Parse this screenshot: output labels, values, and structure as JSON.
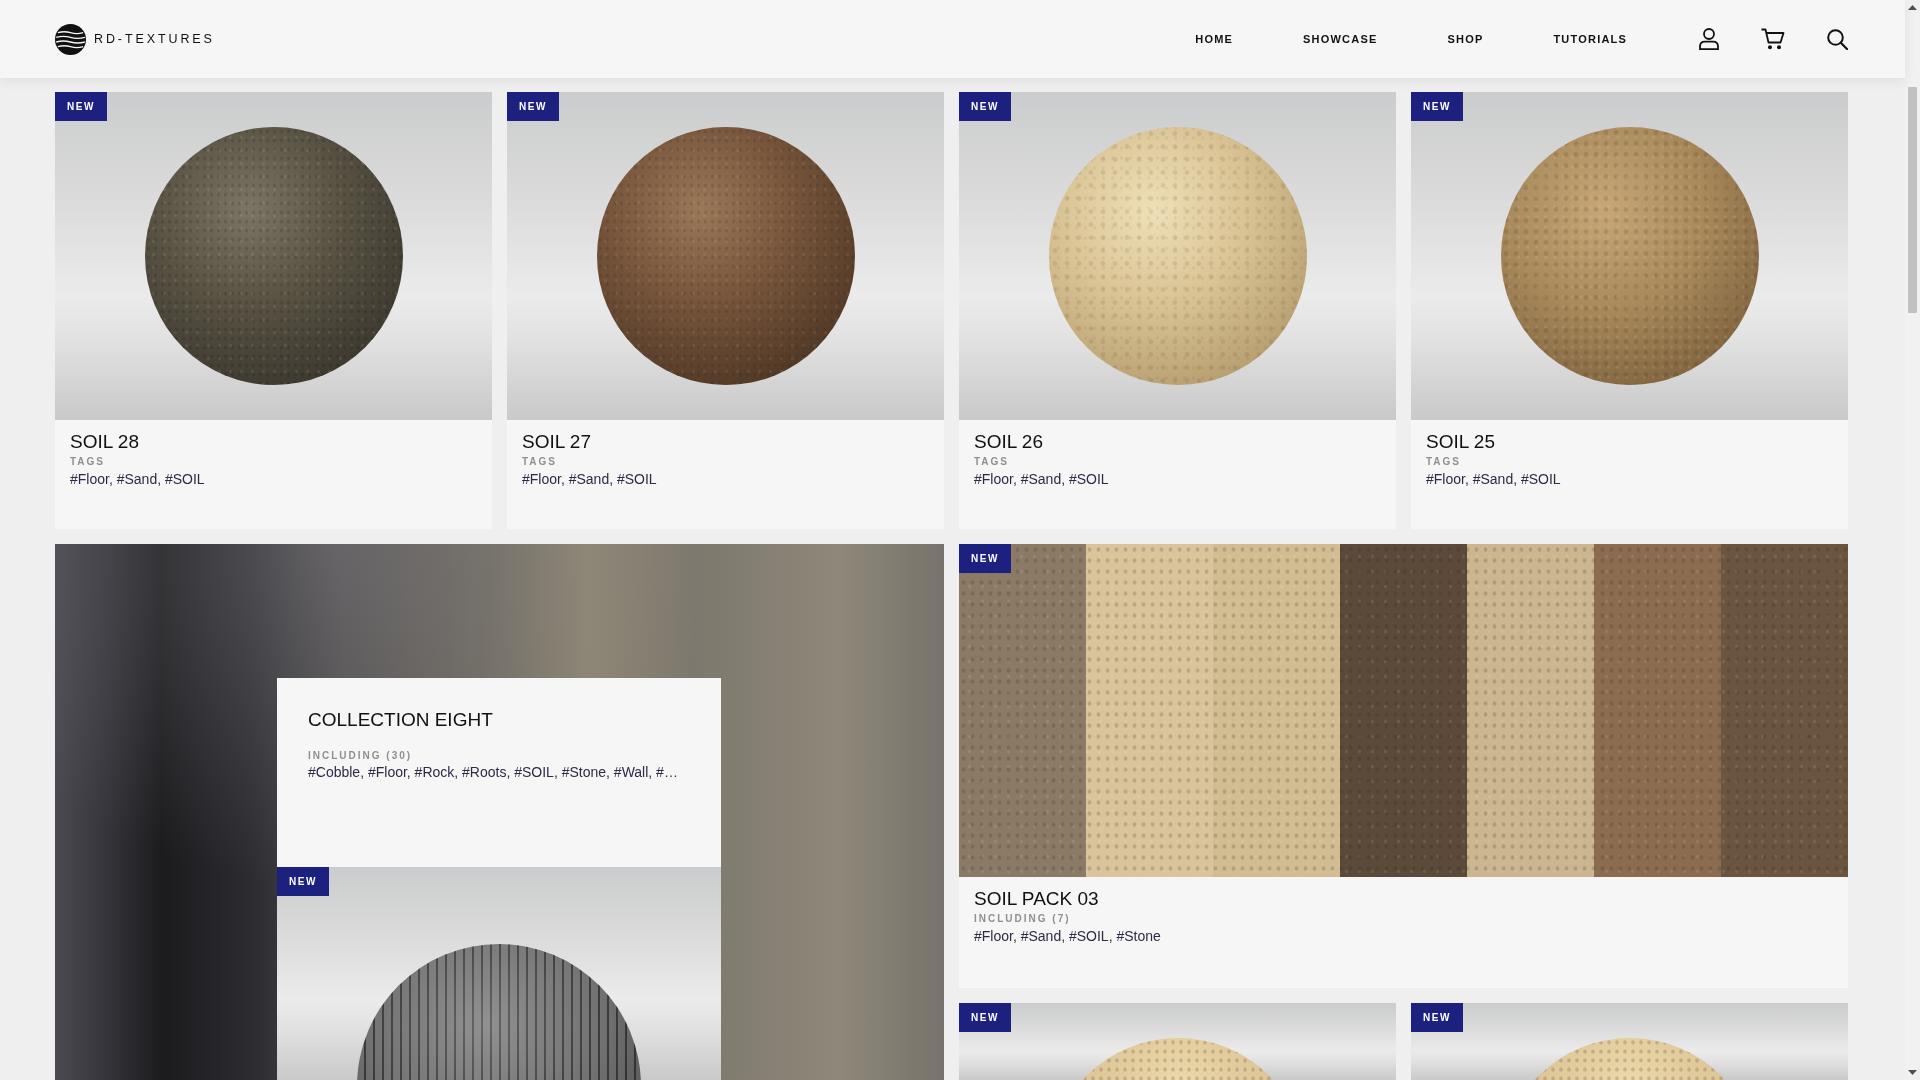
{
  "header": {
    "logo_text": "RD-TEXTURES",
    "nav": [
      "HOME",
      "SHOWCASE",
      "SHOP",
      "TUTORIALS"
    ]
  },
  "products": [
    {
      "kind": "single",
      "badge": "NEW",
      "title": "SOIL 28",
      "meta_label": "TAGS",
      "tags": "#Floor, #Sand, #SOIL"
    },
    {
      "kind": "single",
      "badge": "NEW",
      "title": "SOIL 27",
      "meta_label": "TAGS",
      "tags": "#Floor, #Sand, #SOIL"
    },
    {
      "kind": "single",
      "badge": "NEW",
      "title": "SOIL 26",
      "meta_label": "TAGS",
      "tags": "#Floor, #Sand, #SOIL"
    },
    {
      "kind": "single",
      "badge": "NEW",
      "title": "SOIL 25",
      "meta_label": "TAGS",
      "tags": "#Floor, #Sand, #SOIL"
    },
    {
      "kind": "collection",
      "title": "COLLECTION EIGHT",
      "meta_label": "INCLUDING (30)",
      "tags": "#Cobble, #Floor, #Rock, #Roots, #SOIL, #Stone, #Wall, #…",
      "featured_badge": "NEW"
    },
    {
      "kind": "pack",
      "badge": "NEW",
      "title": "SOIL PACK 03",
      "meta_label": "INCLUDING (7)",
      "tags": "#Floor, #Sand, #SOIL, #Stone"
    },
    {
      "kind": "single",
      "badge": "NEW"
    },
    {
      "kind": "single",
      "badge": "NEW"
    }
  ]
}
